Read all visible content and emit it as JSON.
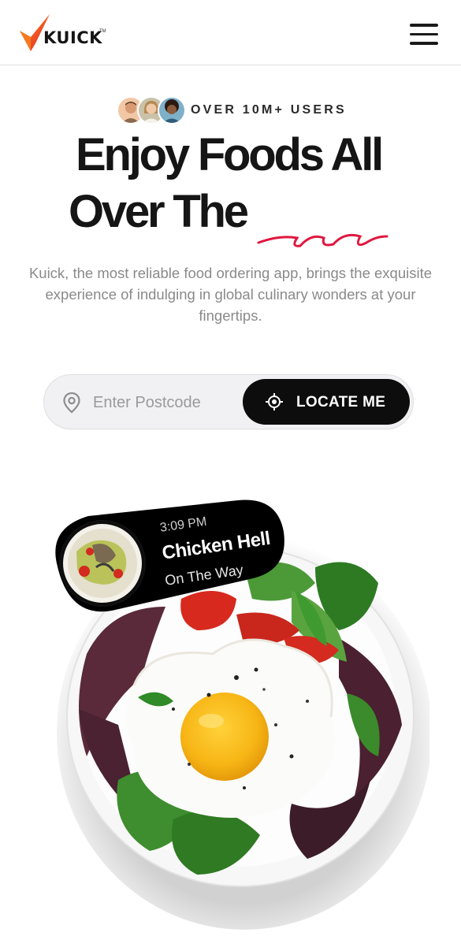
{
  "header": {
    "logo_text": "KUICK",
    "logo_tm": "TM",
    "menu_icon": "hamburger-menu-icon"
  },
  "hero": {
    "users_text": "OVER 10M+ USERS",
    "title_line1": "Enjoy Foods All",
    "title_line2": "Over The",
    "description": "Kuick, the most reliable food ordering app, brings the exquisite experience of indulging in global culinary wonders at your fingertips."
  },
  "search": {
    "placeholder": "Enter Postcode",
    "value": "",
    "locate_label": "LOCATE ME"
  },
  "order_card": {
    "time": "3:09 PM",
    "dish": "Chicken Hell",
    "status": "On The Way"
  },
  "colors": {
    "accent_red": "#e0173f",
    "logo_orange": "#f36b21",
    "dark": "#0d0d0d"
  }
}
